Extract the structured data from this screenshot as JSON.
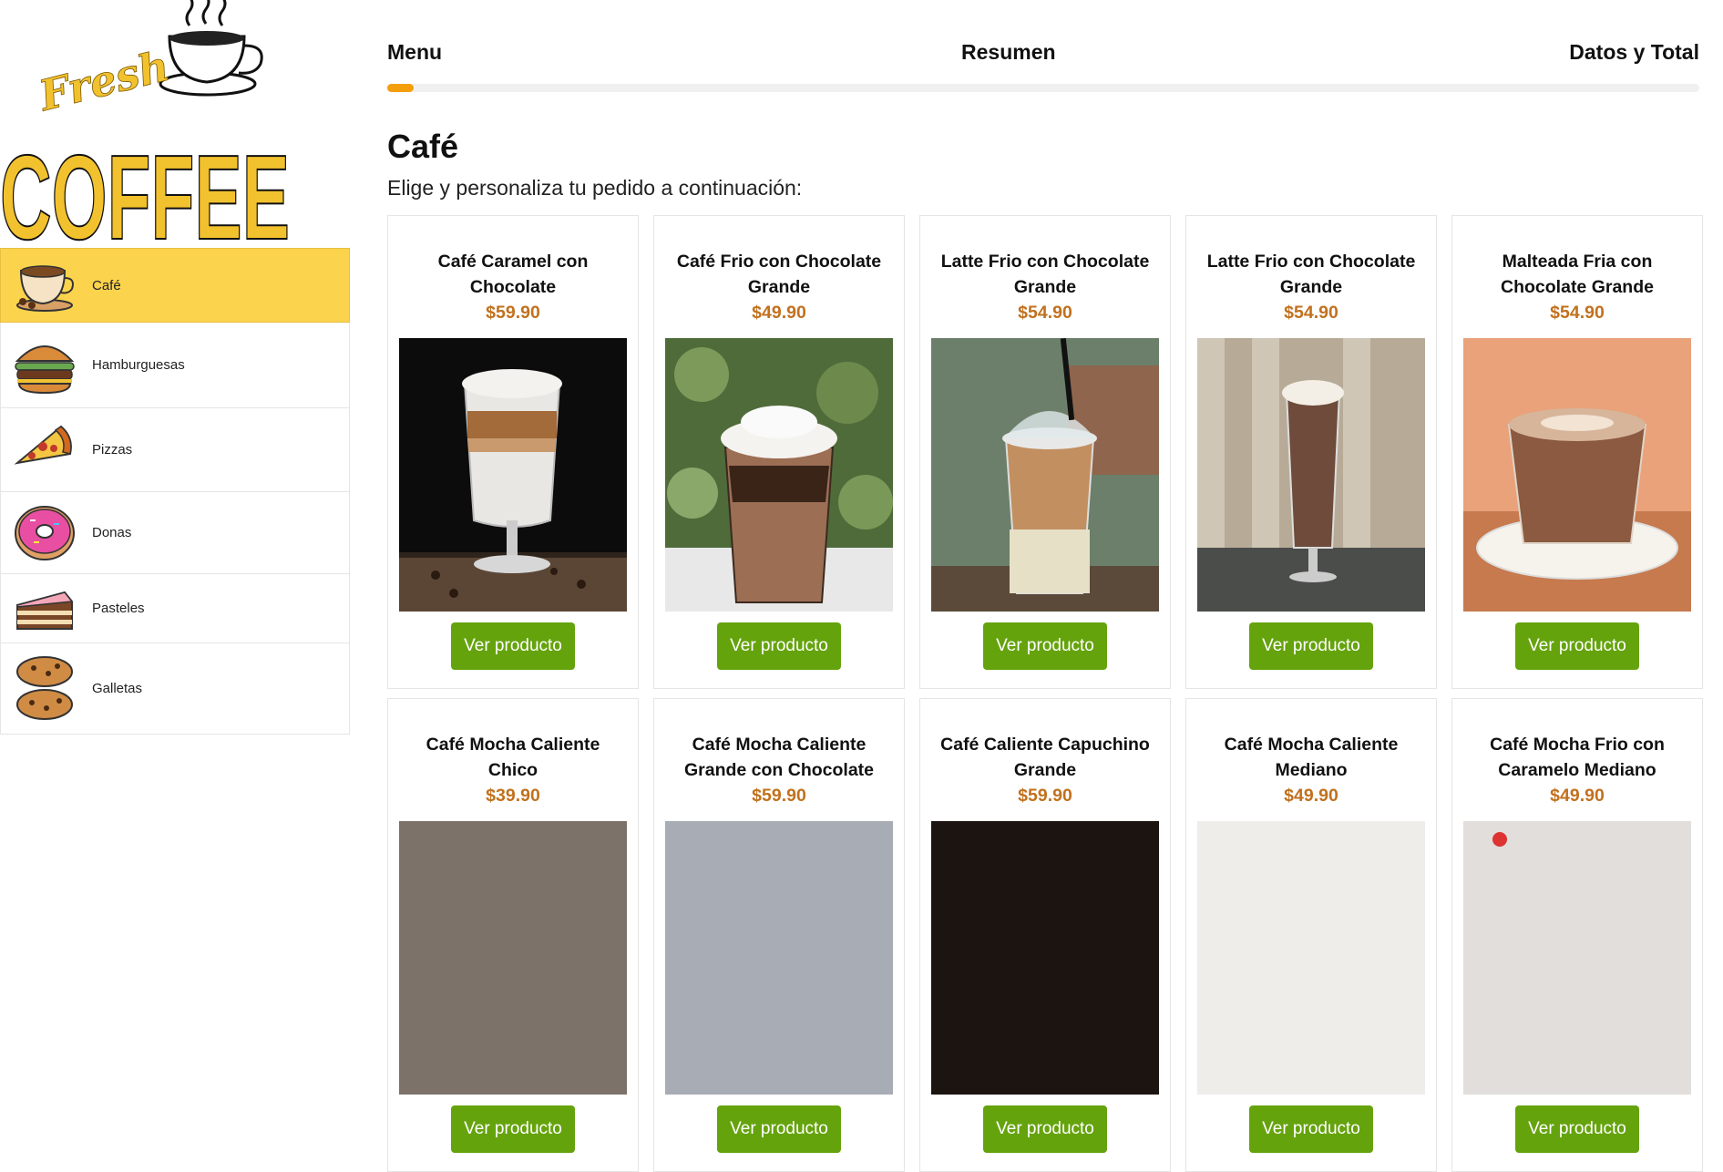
{
  "logo": {
    "word1": "Fresh",
    "word2": "COFFEE"
  },
  "categories": [
    {
      "label": "Café",
      "icon": "coffee-cup-icon",
      "active": true
    },
    {
      "label": "Hamburguesas",
      "icon": "burger-icon"
    },
    {
      "label": "Pizzas",
      "icon": "pizza-icon"
    },
    {
      "label": "Donas",
      "icon": "donut-icon"
    },
    {
      "label": "Pasteles",
      "icon": "cake-icon"
    },
    {
      "label": "Galletas",
      "icon": "cookie-icon"
    }
  ],
  "steps": [
    "Menu",
    "Resumen",
    "Datos y Total"
  ],
  "progress_fraction": 0.02,
  "section": {
    "title": "Café",
    "subtitle": "Elige y personaliza tu pedido a continuación:"
  },
  "products": [
    {
      "name": "Café Caramel con Chocolate",
      "price": "$59.90",
      "button": "Ver producto"
    },
    {
      "name": "Café Frio con Chocolate Grande",
      "price": "$49.90",
      "button": "Ver producto"
    },
    {
      "name": "Latte Frio con Chocolate Grande",
      "price": "$54.90",
      "button": "Ver producto"
    },
    {
      "name": "Latte Frio con Chocolate Grande",
      "price": "$54.90",
      "button": "Ver producto"
    },
    {
      "name": "Malteada Fria con Chocolate Grande",
      "price": "$54.90",
      "button": "Ver producto"
    },
    {
      "name": "Café Mocha Caliente Chico",
      "price": "$39.90",
      "button": "Ver producto"
    },
    {
      "name": "Café Mocha Caliente Grande con Chocolate",
      "price": "$59.90",
      "button": "Ver producto"
    },
    {
      "name": "Café Caliente Capuchino Grande",
      "price": "$59.90",
      "button": "Ver producto"
    },
    {
      "name": "Café Mocha Caliente Mediano",
      "price": "$49.90",
      "button": "Ver producto"
    },
    {
      "name": "Café Mocha Frio con Caramelo Mediano",
      "price": "$49.90",
      "button": "Ver producto"
    }
  ],
  "colors": {
    "accent": "#f59e0b",
    "active_category": "#fcd34d",
    "price": "#c2711d",
    "button": "#65a30d"
  }
}
